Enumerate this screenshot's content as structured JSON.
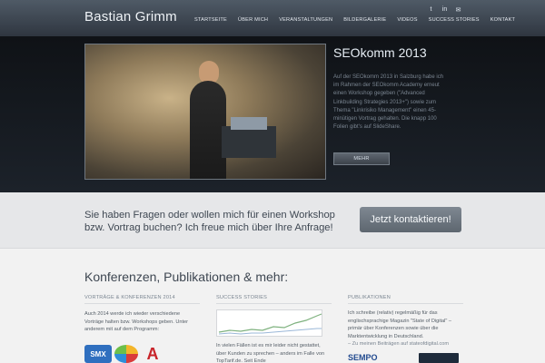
{
  "header": {
    "brand": "Bastian Grimm",
    "nav": [
      "STARTSEITE",
      "ÜBER MICH",
      "VERANSTALTUNGEN",
      "BILDERGALERIE",
      "VIDEOS",
      "SUCCESS STORIES",
      "KONTAKT"
    ],
    "social_icons": [
      "twitter-icon",
      "linkedin-icon",
      "email-icon"
    ]
  },
  "hero": {
    "title": "SEOkomm 2013",
    "text": "Auf der SEOkomm 2013 in Salzburg habe ich im Rahmen der SEOkomm Academy erneut einen Workshop gegeben (\"Advanced Linkbuilding Strategies 2013+\") sowie zum Thema \"Linkrisiko Management\" einen 45-minütigen Vortrag gehalten. Die knapp 100 Folien gibt's auf SlideShare.",
    "more_label": "MEHR",
    "slide_count": 6,
    "active_slide": 1
  },
  "cta": {
    "text": "Sie haben Fragen oder wollen mich für einen Workshop bzw. Vortrag buchen? Ich freue mich über Ihre Anfrage!",
    "button": "Jetzt kontaktieren!"
  },
  "content": {
    "title": "Konferenzen, Publikationen & mehr:",
    "columns": [
      {
        "heading": "VORTRÄGE & KONFERENZEN 2014",
        "text": "Auch 2014 werde ich wieder verschiedene Vorträge halten bzw. Workshops geben. Unter anderem mit auf dem Programm:"
      },
      {
        "heading": "SUCCESS STORIES",
        "text": "In vielen Fällen ist es mir leider nicht gestattet, über Kunden zu sprechen – anders im Falle von TopTarif.de. Seit Ende"
      },
      {
        "heading": "PUBLIKATIONEN",
        "text": "Ich schreibe (relativ) regelmäßig für das englischsprachige Magazin \"State of Digital\" – primär über Konferenzen sowie über die Marktentwicklung in Deutschland.",
        "link": "– Zu meinen Beiträgen auf stateofdigital.com"
      }
    ],
    "logos": [
      "SMX",
      "ring-logo",
      "A",
      "SEMPO",
      "dark-logo"
    ]
  }
}
